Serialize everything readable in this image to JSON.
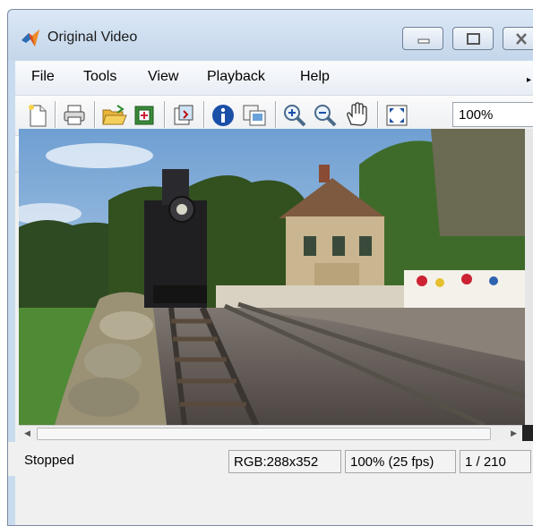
{
  "window": {
    "title": "Original Video"
  },
  "menu": {
    "items": [
      "File",
      "Tools",
      "View",
      "Playback",
      "Help"
    ]
  },
  "toolbar": {
    "zoom_value": "100%",
    "icons": [
      "new-file-icon",
      "print-icon",
      "open-folder-icon",
      "export-icon",
      "import-icon",
      "info-icon",
      "copy-frame-icon",
      "zoom-in-icon",
      "zoom-out-icon",
      "pan-hand-icon",
      "fit-to-window-icon"
    ]
  },
  "playback": {
    "icons": [
      "go-to-first-icon",
      "rewind-icon",
      "step-back-icon",
      "stop-icon",
      "play-icon",
      "step-forward-icon",
      "fast-forward-icon",
      "go-to-last-icon",
      "jump-to-icon",
      "loop-icon",
      "forward-backward-icon"
    ]
  },
  "status": {
    "state": "Stopped",
    "image_info": "RGB:288x352",
    "zoom_fps": "100% (25 fps)",
    "frame": "1 / 210"
  },
  "colors": {
    "play_green": "#22b422",
    "info_blue": "#1a4fa8",
    "titlebar": "#c9dbee"
  }
}
